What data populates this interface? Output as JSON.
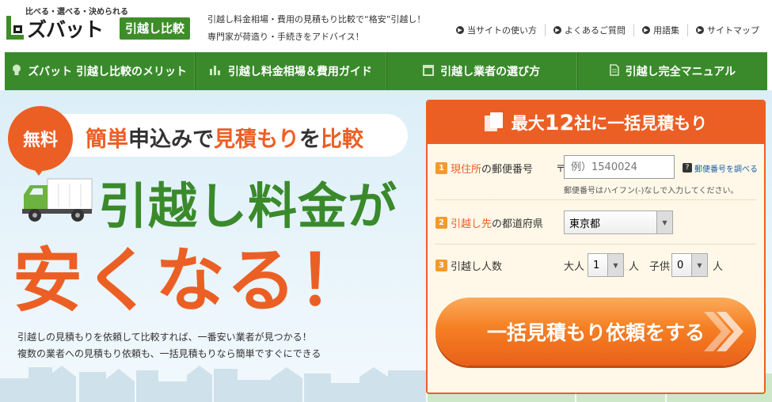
{
  "header": {
    "logo_tagline": "比べる・選べる・決められる",
    "logo_name": "ズバット",
    "logo_sub": "引越し比較",
    "tagline_line1": "引越し料金相場・費用の見積もり比較で“格安”引越し！",
    "tagline_line2": "専門家が荷造り・手続きをアドバイス！",
    "links": [
      {
        "label": "当サイトの使い方",
        "icon": "circle-arrow-icon"
      },
      {
        "label": "よくあるご質問",
        "icon": "circle-arrow-icon"
      },
      {
        "label": "用語集",
        "icon": "circle-arrow-icon"
      },
      {
        "label": "サイトマップ",
        "icon": "circle-arrow-icon"
      }
    ]
  },
  "nav": {
    "items": [
      {
        "label": "ズバット 引越し比較のメリット",
        "icon": "lightbulb-icon"
      },
      {
        "label": "引越し料金相場＆費用ガイド",
        "icon": "bar-chart-icon"
      },
      {
        "label": "引越し業者の選び方",
        "icon": "calendar-icon"
      },
      {
        "label": "引越し完全マニュアル",
        "icon": "document-icon"
      }
    ]
  },
  "hero": {
    "free_badge": "無料",
    "sub_part1": "簡単",
    "sub_part2": "申込みで",
    "sub_part3": "見積もり",
    "sub_part4": "を",
    "sub_part5": "比較",
    "main_line1": "引越し料金が",
    "main_line2": "安くなる！",
    "desc_line1": "引越しの見積もりを依頼して比較すれば、一番安い業者が見つかる！",
    "desc_line2": "複数の業者への見積もり依頼も、一括見積もりなら簡単ですぐにできる"
  },
  "form": {
    "title_pre": "最大",
    "title_num": "12",
    "title_post": "社に一括見積もり",
    "fields": {
      "zip": {
        "num": "1",
        "label_highlight": "現住所",
        "label_rest": "の郵便番号",
        "zip_mark": "〒",
        "placeholder": "例）1540024",
        "help_icon": "?",
        "help_link": "郵便番号を調べる",
        "hint": "郵便番号はハイフン(-)なしで入力してください。"
      },
      "destination": {
        "num": "2",
        "label_highlight": "引越し先",
        "label_rest": "の都道府県",
        "value": "東京都"
      },
      "people": {
        "num": "3",
        "label": "引越し人数",
        "adult_label": "大人",
        "adult_value": "1",
        "adult_unit": "人",
        "child_label": "子供",
        "child_value": "0",
        "child_unit": "人"
      }
    },
    "submit_label": "一括見積もり依頼をする"
  },
  "colors": {
    "brand_green": "#3a8a2c",
    "brand_orange": "#ec5f24",
    "link_blue": "#1a5ea8"
  }
}
